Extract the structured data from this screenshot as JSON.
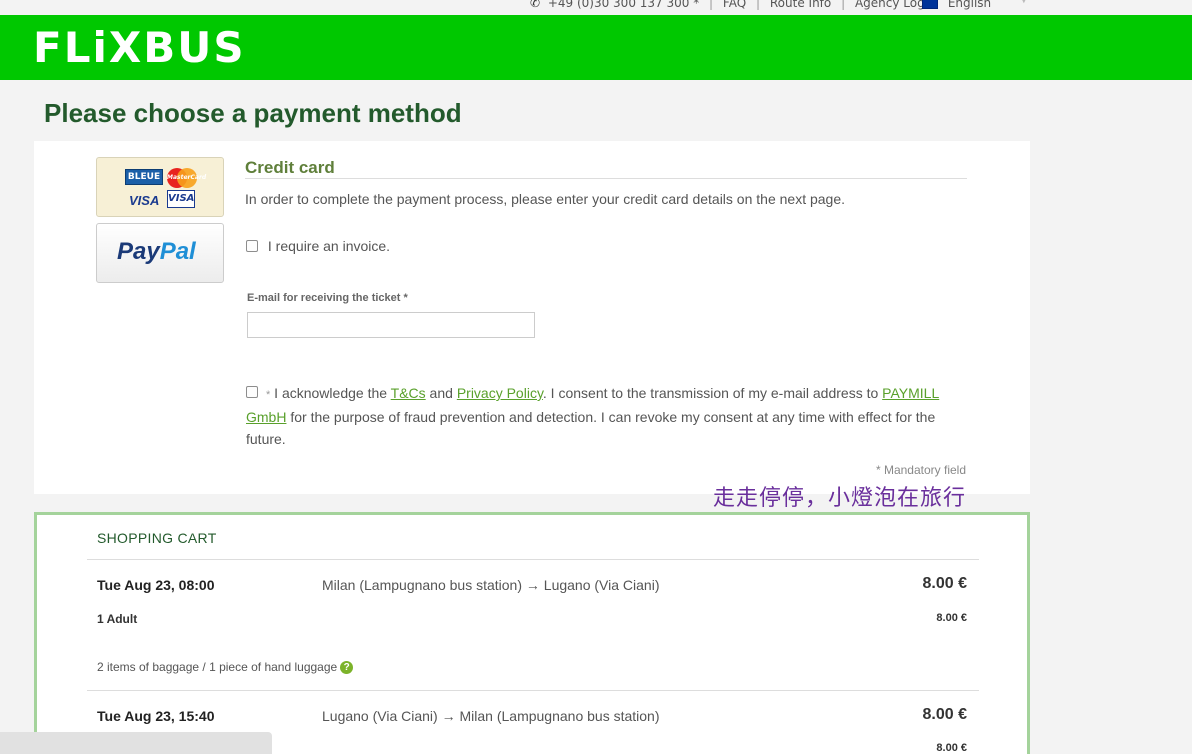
{
  "topbar": {
    "phone": "+49 (0)30 300 137 300 *",
    "faq": "FAQ",
    "route_info": "Route Info",
    "agency_login": "Agency Login",
    "language": "English"
  },
  "header": {
    "logo": "FLiXBUS"
  },
  "page": {
    "title": "Please choose a payment method"
  },
  "payment_methods": {
    "credit_card_logos": {
      "bleue": "BLEUE",
      "mastercard": "MasterCard",
      "visa": "VISA"
    },
    "paypal_pay": "Pay",
    "paypal_pal": "Pal"
  },
  "credit_card": {
    "heading": "Credit card",
    "description": "In order to complete the payment process, please enter your credit card details on the next page.",
    "invoice_label": "I require an invoice.",
    "email_label": "E-mail for receiving the ticket *",
    "email_value": "",
    "consent_required_mark": "*",
    "consent_part1": " I acknowledge the ",
    "tcs_link": "T&Cs",
    "consent_and": " and ",
    "privacy_link": "Privacy Policy",
    "consent_part2": ". I consent to the transmission of my e-mail address to ",
    "paymill_link": "PAYMILL GmbH",
    "consent_part3": " for the purpose of fraud prevention and detection. I can revoke my consent at any time with effect for the future.",
    "mandatory_note": "*  Mandatory field"
  },
  "watermark": "走走停停，小燈泡在旅行",
  "cart": {
    "title": "SHOPPING CART",
    "trips": [
      {
        "date": "Tue Aug 23, 08:00",
        "route": "Milan (Lampugnano bus station) → Lugano (Via Ciani)",
        "price": "8.00 €",
        "passengers": "1 Adult",
        "passenger_price": "8.00 €",
        "baggage": "2 items of baggage / 1 piece of hand luggage"
      },
      {
        "date": "Tue Aug 23, 15:40",
        "route": "Lugano (Via Ciani) → Milan (Lampugnano bus station)",
        "price": "8.00 €",
        "passenger_price": "8.00 €"
      }
    ]
  },
  "colors": {
    "brand_green": "#00c800",
    "title_green": "#235a2c",
    "link_green": "#59a02b",
    "cart_border": "#a4d39b"
  }
}
